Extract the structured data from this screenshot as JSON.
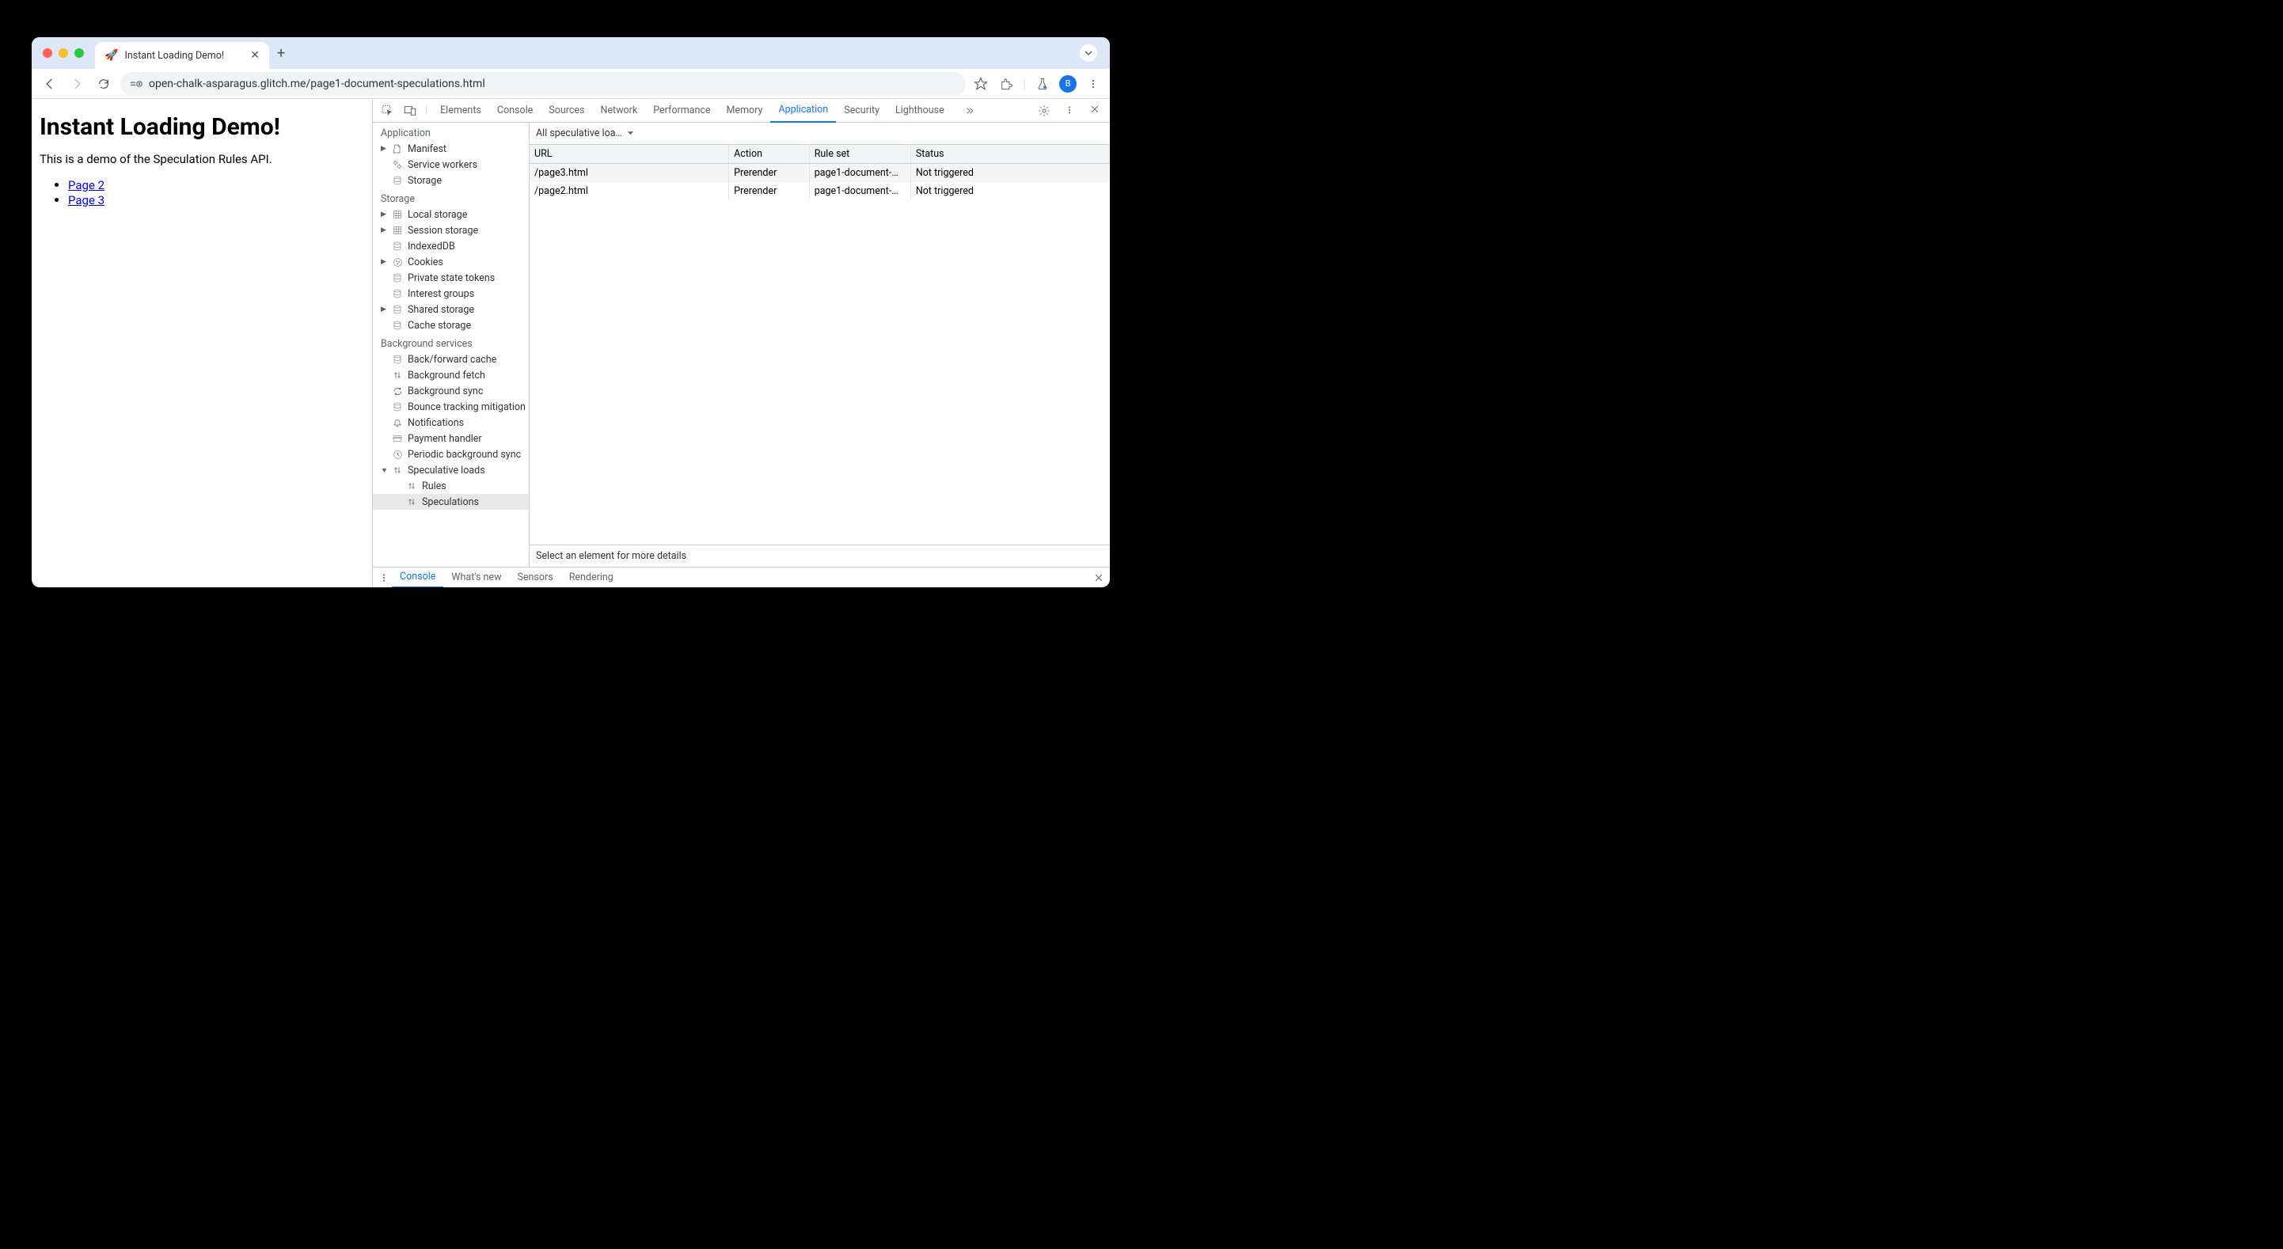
{
  "browser": {
    "tab_title": "Instant Loading Demo!",
    "favicon": "🚀",
    "url": "open-chalk-asparagus.glitch.me/page1-document-speculations.html",
    "avatar_letter": "B"
  },
  "page": {
    "heading": "Instant Loading Demo!",
    "description": "This is a demo of the Speculation Rules API.",
    "links": [
      "Page 2",
      "Page 3"
    ]
  },
  "devtools": {
    "tabs": [
      "Elements",
      "Console",
      "Sources",
      "Network",
      "Performance",
      "Memory",
      "Application",
      "Security",
      "Lighthouse"
    ],
    "active_tab": "Application",
    "sidebar": {
      "sections": [
        {
          "title": "Application",
          "items": [
            {
              "label": "Manifest",
              "icon": "file",
              "arrow": true
            },
            {
              "label": "Service workers",
              "icon": "gears"
            },
            {
              "label": "Storage",
              "icon": "db"
            }
          ]
        },
        {
          "title": "Storage",
          "items": [
            {
              "label": "Local storage",
              "icon": "grid",
              "arrow": true
            },
            {
              "label": "Session storage",
              "icon": "grid",
              "arrow": true
            },
            {
              "label": "IndexedDB",
              "icon": "db"
            },
            {
              "label": "Cookies",
              "icon": "cookie",
              "arrow": true
            },
            {
              "label": "Private state tokens",
              "icon": "db"
            },
            {
              "label": "Interest groups",
              "icon": "db"
            },
            {
              "label": "Shared storage",
              "icon": "db",
              "arrow": true
            },
            {
              "label": "Cache storage",
              "icon": "db"
            }
          ]
        },
        {
          "title": "Background services",
          "items": [
            {
              "label": "Back/forward cache",
              "icon": "db"
            },
            {
              "label": "Background fetch",
              "icon": "updown"
            },
            {
              "label": "Background sync",
              "icon": "sync"
            },
            {
              "label": "Bounce tracking mitigation",
              "icon": "db"
            },
            {
              "label": "Notifications",
              "icon": "bell"
            },
            {
              "label": "Payment handler",
              "icon": "card"
            },
            {
              "label": "Periodic background sync",
              "icon": "clock"
            },
            {
              "label": "Speculative loads",
              "icon": "updown",
              "arrow": true,
              "expanded": true,
              "children": [
                {
                  "label": "Rules",
                  "icon": "updown"
                },
                {
                  "label": "Speculations",
                  "icon": "updown",
                  "selected": true
                }
              ]
            }
          ]
        }
      ]
    },
    "dropdown": "All speculative loa…",
    "table": {
      "headers": [
        "URL",
        "Action",
        "Rule set",
        "Status"
      ],
      "rows": [
        {
          "url": "/page3.html",
          "action": "Prerender",
          "ruleset": "page1-document-…",
          "status": "Not triggered"
        },
        {
          "url": "/page2.html",
          "action": "Prerender",
          "ruleset": "page1-document-…",
          "status": "Not triggered"
        }
      ]
    },
    "details_hint": "Select an element for more details",
    "drawer_tabs": [
      "Console",
      "What's new",
      "Sensors",
      "Rendering"
    ],
    "drawer_active": "Console"
  }
}
